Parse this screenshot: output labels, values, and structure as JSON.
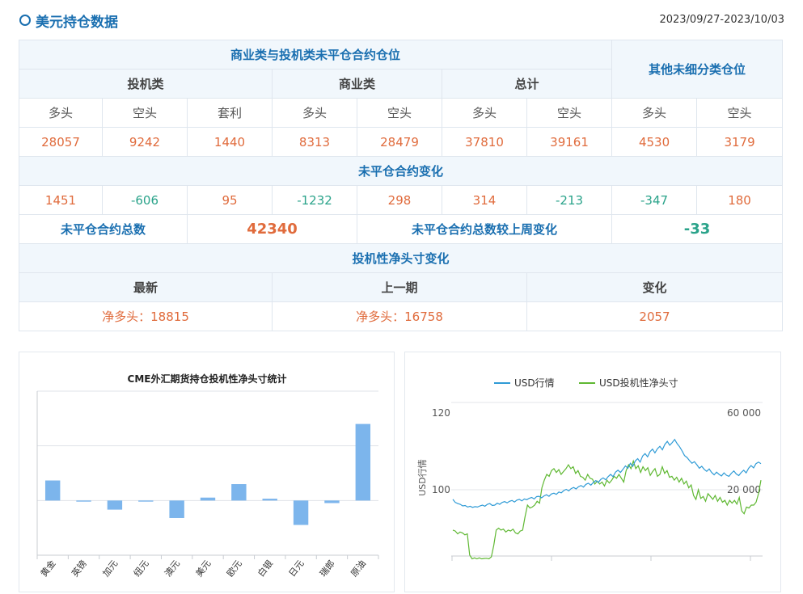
{
  "header": {
    "title": "美元持仓数据",
    "date_range": "2023/09/27-2023/10/03"
  },
  "table": {
    "group_headers": {
      "main": "商业类与投机类未平仓合约仓位",
      "other": "其他未细分类仓位",
      "spec": "投机类",
      "comm": "商业类",
      "total": "总计"
    },
    "sub_headers": [
      "多头",
      "空头",
      "套利",
      "多头",
      "空头",
      "多头",
      "空头",
      "多头",
      "空头"
    ],
    "positions": [
      "28057",
      "9242",
      "1440",
      "8313",
      "28479",
      "37810",
      "39161",
      "4530",
      "3179"
    ],
    "change_title": "未平仓合约变化",
    "changes": [
      "1451",
      "-606",
      "95",
      "-1232",
      "298",
      "314",
      "-213",
      "-347",
      "180"
    ],
    "total_label": "未平仓合约总数",
    "total_value": "42340",
    "weekly_change_label": "未平仓合约总数较上周变化",
    "weekly_change_value": "-33",
    "net_title": "投机性净头寸变化",
    "net_headers": [
      "最新",
      "上一期",
      "变化"
    ],
    "net_latest": "净多头：18815",
    "net_previous": "净多头：16758",
    "net_change": "2057"
  },
  "chart_data": [
    {
      "type": "bar",
      "title": "CME外汇期货持仓投机性净头寸统计",
      "categories": [
        "黄金",
        "英镑",
        "加元",
        "纽元",
        "澳元",
        "美元",
        "欧元",
        "白银",
        "日元",
        "瑞郎",
        "原油"
      ],
      "values": [
        55000,
        -3000,
        -25000,
        -3000,
        -48000,
        8000,
        45000,
        5000,
        -67000,
        -7000,
        210000
      ],
      "ylim": [
        -150000,
        300000
      ],
      "bar_color": "#7cb5ec",
      "grid": true
    },
    {
      "type": "line",
      "legend_position": "top",
      "ylabel_left": "USD行情",
      "left_ticks": [
        "120",
        "100"
      ],
      "right_ticks": [
        "60 000",
        "20 000"
      ],
      "left_range": [
        90,
        120
      ],
      "right_range": [
        -20000,
        60000
      ],
      "series": [
        {
          "name": "USD行情",
          "axis": "left",
          "color": "#2f9bd6",
          "values": [
            97.5,
            96.7,
            96.4,
            96.2,
            95.8,
            95.9,
            95.5,
            95.7,
            95.4,
            95.6,
            95.5,
            95.8,
            96.0,
            95.7,
            96.2,
            96.4,
            95.9,
            96.0,
            96.5,
            96.2,
            96.7,
            96.9,
            96.6,
            97.0,
            97.2,
            96.8,
            97.3,
            97.5,
            97.1,
            97.6,
            97.4,
            97.8,
            98.0,
            97.6,
            98.2,
            98.3,
            97.9,
            98.4,
            98.7,
            98.3,
            98.9,
            99.1,
            98.8,
            99.4,
            99.2,
            99.8,
            100.1,
            99.7,
            100.3,
            100.6,
            100.2,
            100.8,
            101.1,
            100.7,
            101.4,
            101.7,
            101.2,
            101.9,
            102.4,
            101.9,
            102.7,
            103.1,
            102.6,
            103.4,
            104.0,
            103.4,
            104.6,
            105.1,
            104.5,
            105.3,
            106.2,
            105.6,
            106.9,
            106.1,
            107.5,
            108.1,
            107.2,
            108.8,
            109.4,
            108.6,
            109.9,
            110.6,
            109.6,
            110.7,
            111.3,
            110.4,
            111.8,
            112.6,
            111.6,
            112.3,
            113.1,
            112.0,
            111.2,
            110.1,
            108.9,
            108.4,
            107.6,
            106.9,
            107.3,
            106.5,
            105.6,
            106.1,
            105.3,
            104.8,
            105.4,
            104.5,
            103.9,
            104.6,
            104.0,
            103.6,
            104.4,
            103.8,
            103.5,
            104.3,
            104.9,
            104.1,
            103.7,
            104.5,
            105.1,
            104.4,
            105.6,
            106.3,
            105.7,
            106.8,
            107.2,
            106.8
          ]
        },
        {
          "name": "USD投机性净头寸",
          "axis": "right",
          "color": "#5fb832",
          "values": [
            -1000,
            -1500,
            -3000,
            -2000,
            -2500,
            -3500,
            -3000,
            -14000,
            -16000,
            -15500,
            -16000,
            -15500,
            -16000,
            -15800,
            -15700,
            -16000,
            -15000,
            -9000,
            -1000,
            0,
            -1000,
            -500,
            -2000,
            -1000,
            -1500,
            -500,
            -2500,
            -3000,
            -1500,
            -1000,
            6000,
            12000,
            10500,
            11000,
            12000,
            14000,
            13000,
            21000,
            25000,
            28000,
            27000,
            30000,
            31000,
            29000,
            30500,
            28000,
            29500,
            31000,
            33000,
            31000,
            32000,
            28500,
            30000,
            27000,
            26500,
            25000,
            28000,
            26000,
            25500,
            23000,
            24500,
            23000,
            24000,
            22000,
            25000,
            23500,
            25000,
            27000,
            26000,
            28000,
            26000,
            24000,
            30000,
            33000,
            31000,
            35000,
            31000,
            32500,
            29000,
            32000,
            30000,
            31500,
            27500,
            29500,
            31000,
            27000,
            28000,
            32000,
            28500,
            30000,
            26500,
            27000,
            25000,
            26500,
            24000,
            26000,
            23000,
            24500,
            21000,
            22500,
            17000,
            15000,
            20000,
            15500,
            16500,
            14000,
            18000,
            16500,
            15000,
            17000,
            14000,
            16000,
            13500,
            14500,
            12000,
            14500,
            13000,
            14500,
            12500,
            16000,
            9000,
            7500,
            11000,
            10500,
            12000,
            12000,
            13500,
            18000,
            25000
          ]
        }
      ]
    }
  ]
}
